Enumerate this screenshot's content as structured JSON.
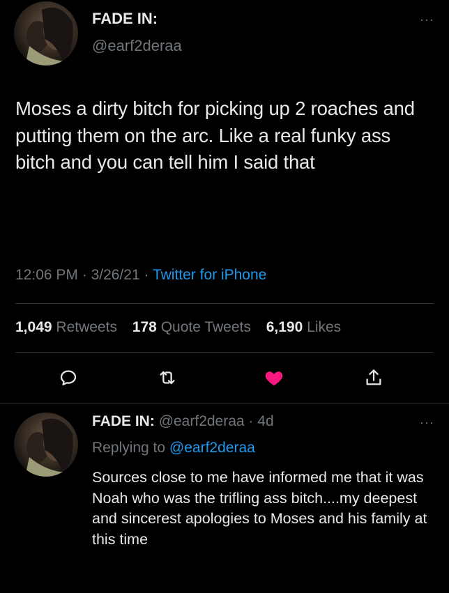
{
  "tweet": {
    "author_name": "FADE IN:",
    "author_handle": "@earf2deraa",
    "text": "Moses a dirty bitch for picking up 2 roaches and putting them on the arc. Like a real funky ass bitch and you can tell him I said that",
    "time": "12:06 PM",
    "date": "3/26/21",
    "source": "Twitter for iPhone",
    "stats": {
      "retweets_count": "1,049",
      "retweets_label": "Retweets",
      "quotes_count": "178",
      "quotes_label": "Quote Tweets",
      "likes_count": "6,190",
      "likes_label": "Likes"
    },
    "actions": [
      "reply-icon",
      "retweet-icon",
      "heart-filled-icon",
      "share-icon"
    ],
    "more_label": "···",
    "accent_color": "#1d9bf0",
    "like_color": "#f91880"
  },
  "reply": {
    "author_name": "FADE IN:",
    "author_handle": "@earf2deraa",
    "age": "4d",
    "replying_prefix": "Replying to",
    "replying_to": "@earf2deraa",
    "text": "Sources close to me have informed me that it was Noah who was the trifling ass bitch....my deepest and sincerest apologies to Moses and his family at this time",
    "more_label": "···"
  }
}
